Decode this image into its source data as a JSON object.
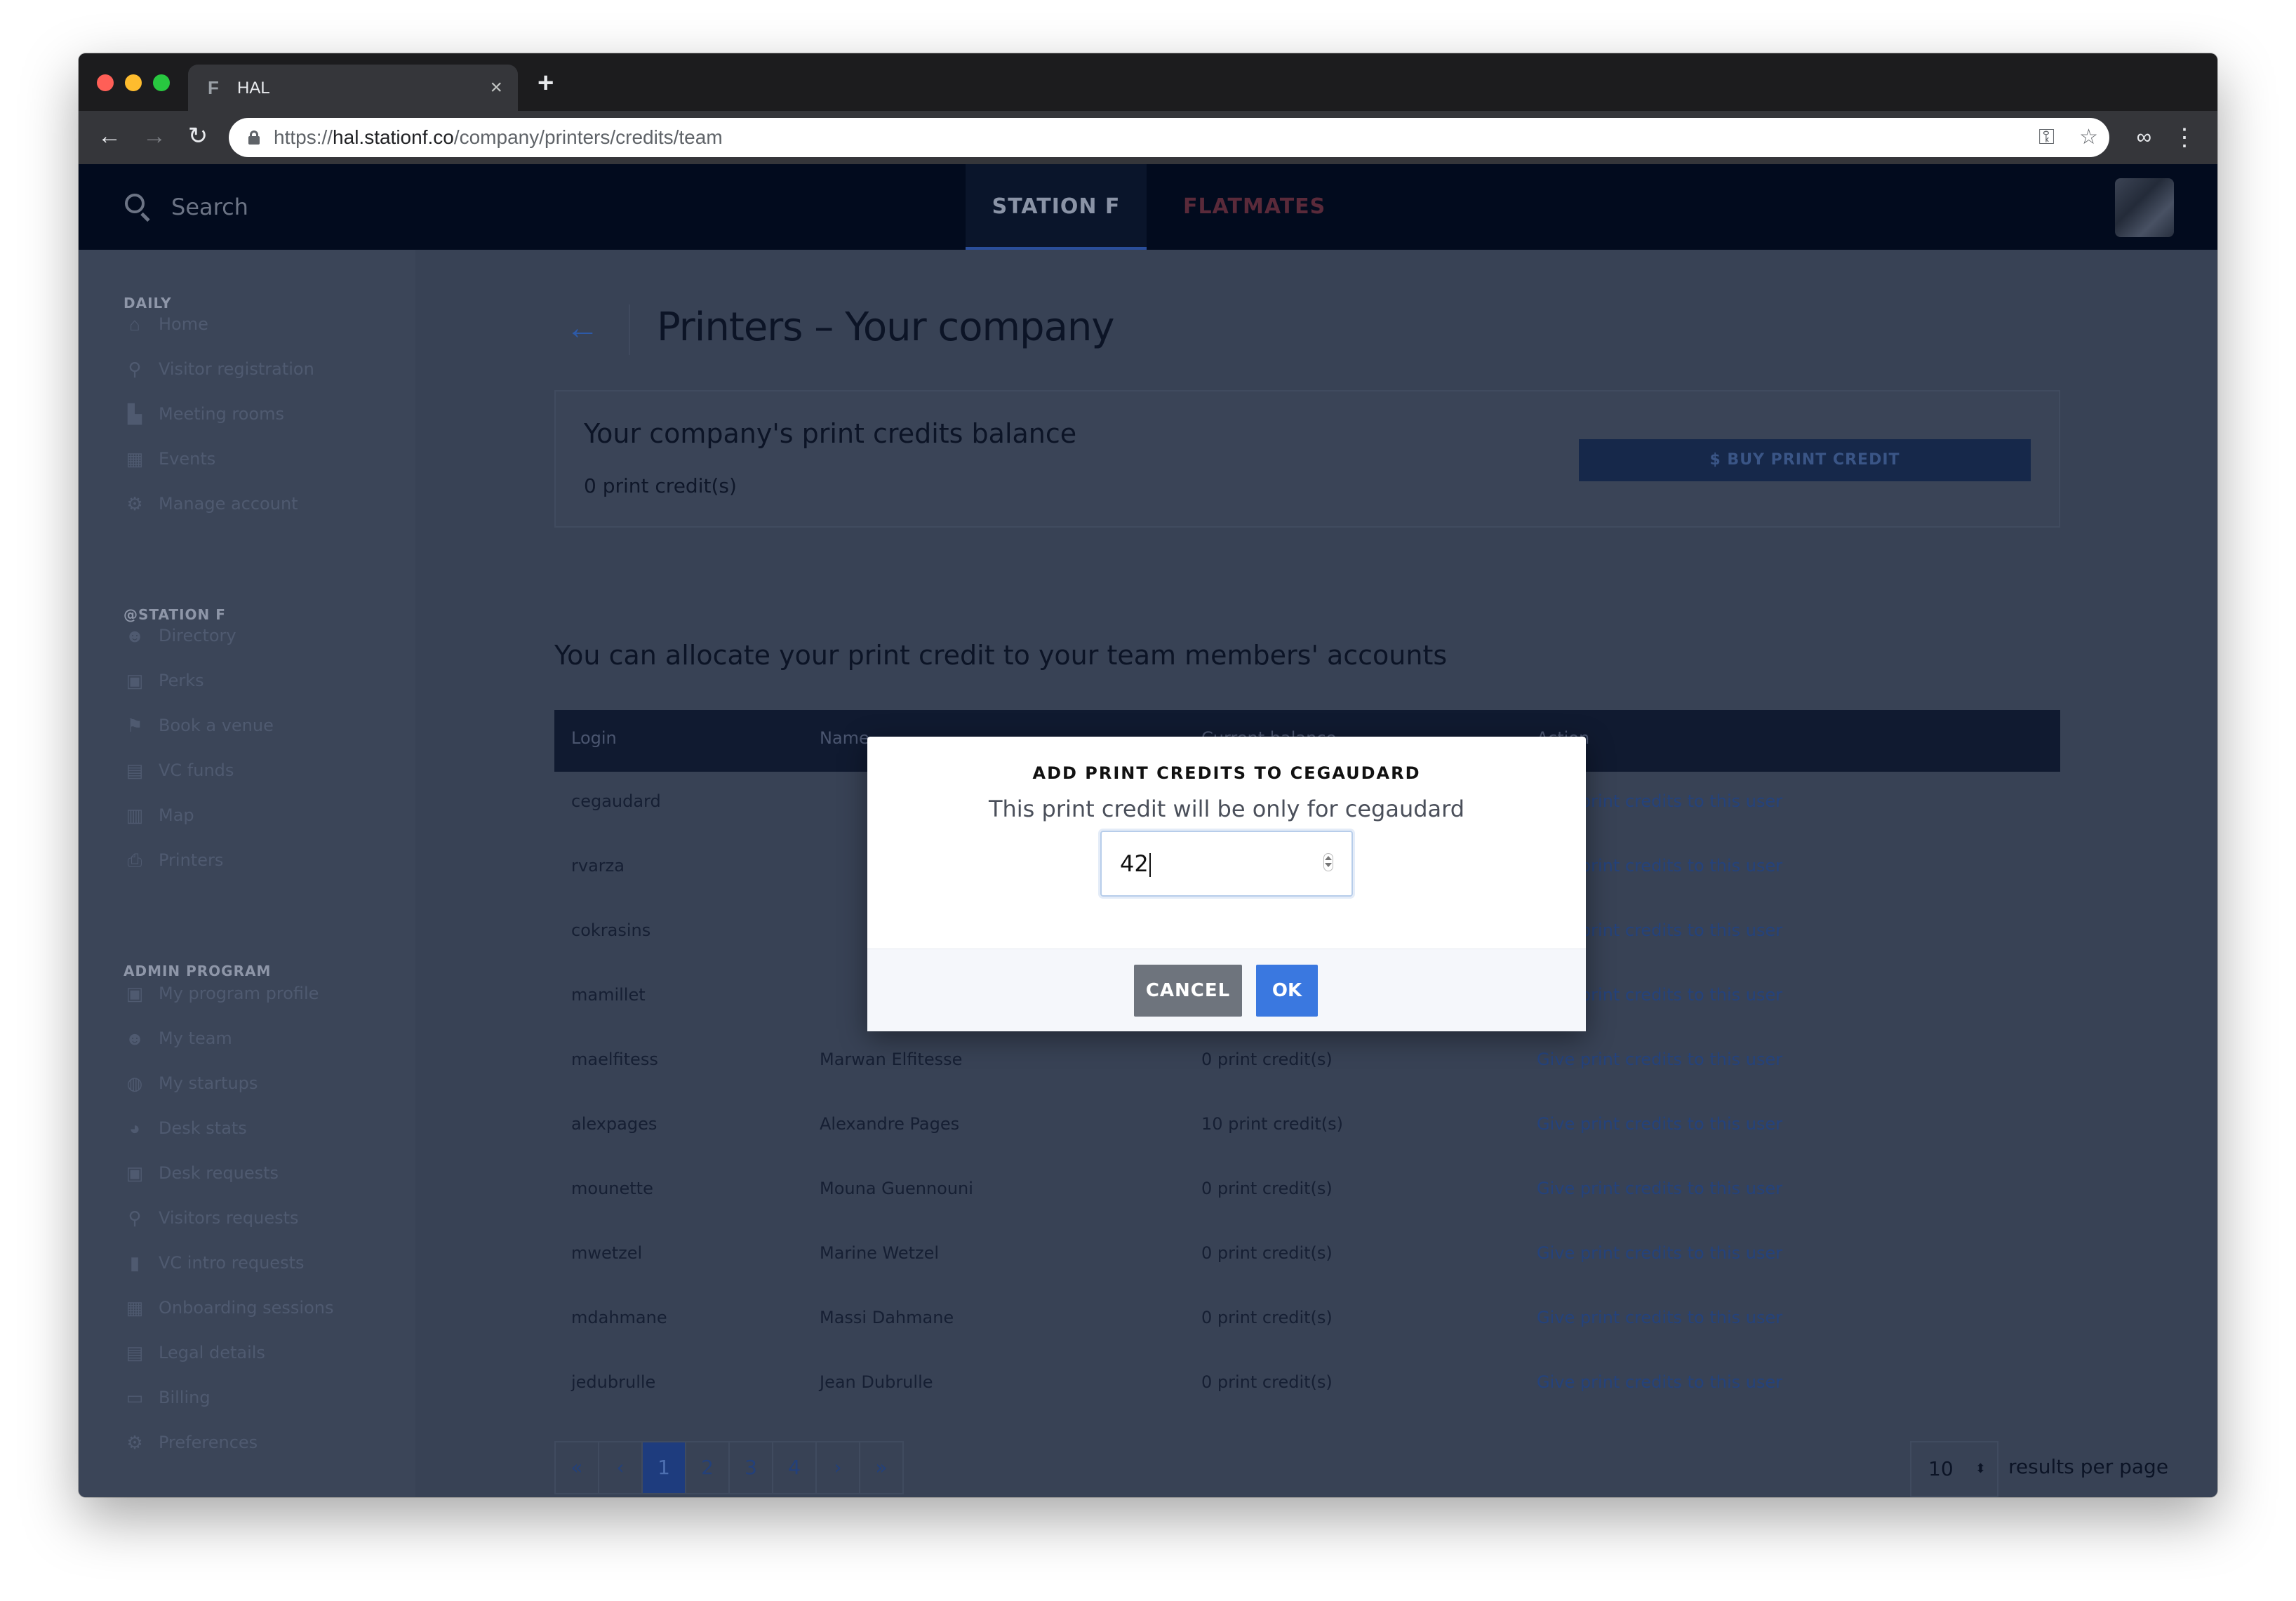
{
  "browser": {
    "tab_title": "HAL",
    "tab_favicon": "F",
    "url_scheme": "https://",
    "url_host": "hal.stationf.co",
    "url_path": "/company/printers/credits/team"
  },
  "header": {
    "search_label": "Search",
    "tabs": [
      {
        "label": "STATION F",
        "active": true
      },
      {
        "label": "FLATMATES",
        "active": false
      }
    ]
  },
  "sidebar": {
    "sections": [
      {
        "title": "DAILY",
        "items": [
          {
            "label": "Home",
            "icon": "home-icon"
          },
          {
            "label": "Visitor registration",
            "icon": "walking-icon"
          },
          {
            "label": "Meeting rooms",
            "icon": "building-icon"
          },
          {
            "label": "Events",
            "icon": "calendar-icon"
          },
          {
            "label": "Manage account",
            "icon": "gear-icon"
          }
        ]
      },
      {
        "title": "@STATION F",
        "items": [
          {
            "label": "Directory",
            "icon": "people-icon"
          },
          {
            "label": "Perks",
            "icon": "gift-icon"
          },
          {
            "label": "Book a venue",
            "icon": "flag-icon"
          },
          {
            "label": "VC funds",
            "icon": "wallet-icon"
          },
          {
            "label": "Map",
            "icon": "map-icon"
          },
          {
            "label": "Printers",
            "icon": "printer-icon"
          }
        ]
      },
      {
        "title": "ADMIN PROGRAM",
        "items": [
          {
            "label": "My program profile",
            "icon": "profile-icon"
          },
          {
            "label": "My team",
            "icon": "people-icon"
          },
          {
            "label": "My startups",
            "icon": "globe-icon"
          },
          {
            "label": "Desk stats",
            "icon": "pie-icon"
          },
          {
            "label": "Desk requests",
            "icon": "profile-icon"
          },
          {
            "label": "Visitors requests",
            "icon": "walking-icon"
          },
          {
            "label": "VC intro requests",
            "icon": "book-icon"
          },
          {
            "label": "Onboarding sessions",
            "icon": "calendar-icon"
          },
          {
            "label": "Legal details",
            "icon": "library-icon"
          },
          {
            "label": "Billing",
            "icon": "card-icon"
          },
          {
            "label": "Preferences",
            "icon": "gear-icon"
          }
        ]
      }
    ]
  },
  "main": {
    "page_title": "Printers – Your company",
    "balance_title": "Your company's print credits balance",
    "balance_value": "0 print credit(s)",
    "buy_button": "$  BUY PRINT CREDIT",
    "allocate_title": "You can allocate your print credit to your team members' accounts",
    "table": {
      "headers": [
        "Login",
        "Name",
        "Current balance",
        "Action"
      ],
      "rows": [
        {
          "login": "cegaudard",
          "name": "",
          "balance": "",
          "action": "Give print credits to this user"
        },
        {
          "login": "rvarza",
          "name": "",
          "balance": "",
          "action": "Give print credits to this user"
        },
        {
          "login": "cokrasins",
          "name": "",
          "balance": "",
          "action": "Give print credits to this user"
        },
        {
          "login": "mamillet",
          "name": "",
          "balance": "",
          "action": "Give print credits to this user"
        },
        {
          "login": "maelfitess",
          "name": "Marwan Elfitesse",
          "balance": "0 print credit(s)",
          "action": "Give print credits to this user"
        },
        {
          "login": "alexpages",
          "name": "Alexandre Pages",
          "balance": "10 print credit(s)",
          "action": "Give print credits to this user"
        },
        {
          "login": "mounette",
          "name": "Mouna Guennouni",
          "balance": "0 print credit(s)",
          "action": "Give print credits to this user"
        },
        {
          "login": "mwetzel",
          "name": "Marine Wetzel",
          "balance": "0 print credit(s)",
          "action": "Give print credits to this user"
        },
        {
          "login": "mdahmane",
          "name": "Massi Dahmane",
          "balance": "0 print credit(s)",
          "action": "Give print credits to this user"
        },
        {
          "login": "jedubrulle",
          "name": "Jean Dubrulle",
          "balance": "0 print credit(s)",
          "action": "Give print credits to this user"
        }
      ]
    },
    "pagination": {
      "first": "«",
      "prev": "‹",
      "pages": [
        "1",
        "2",
        "3",
        "4"
      ],
      "active_page": "1",
      "next": "›",
      "last": "»"
    },
    "per_page": {
      "value": "10",
      "label": "results per page"
    }
  },
  "modal": {
    "title": "ADD PRINT CREDITS TO CEGAUDARD",
    "text": "This print credit will be only for cegaudard",
    "input_value": "42",
    "cancel_label": "CANCEL",
    "ok_label": "OK"
  }
}
